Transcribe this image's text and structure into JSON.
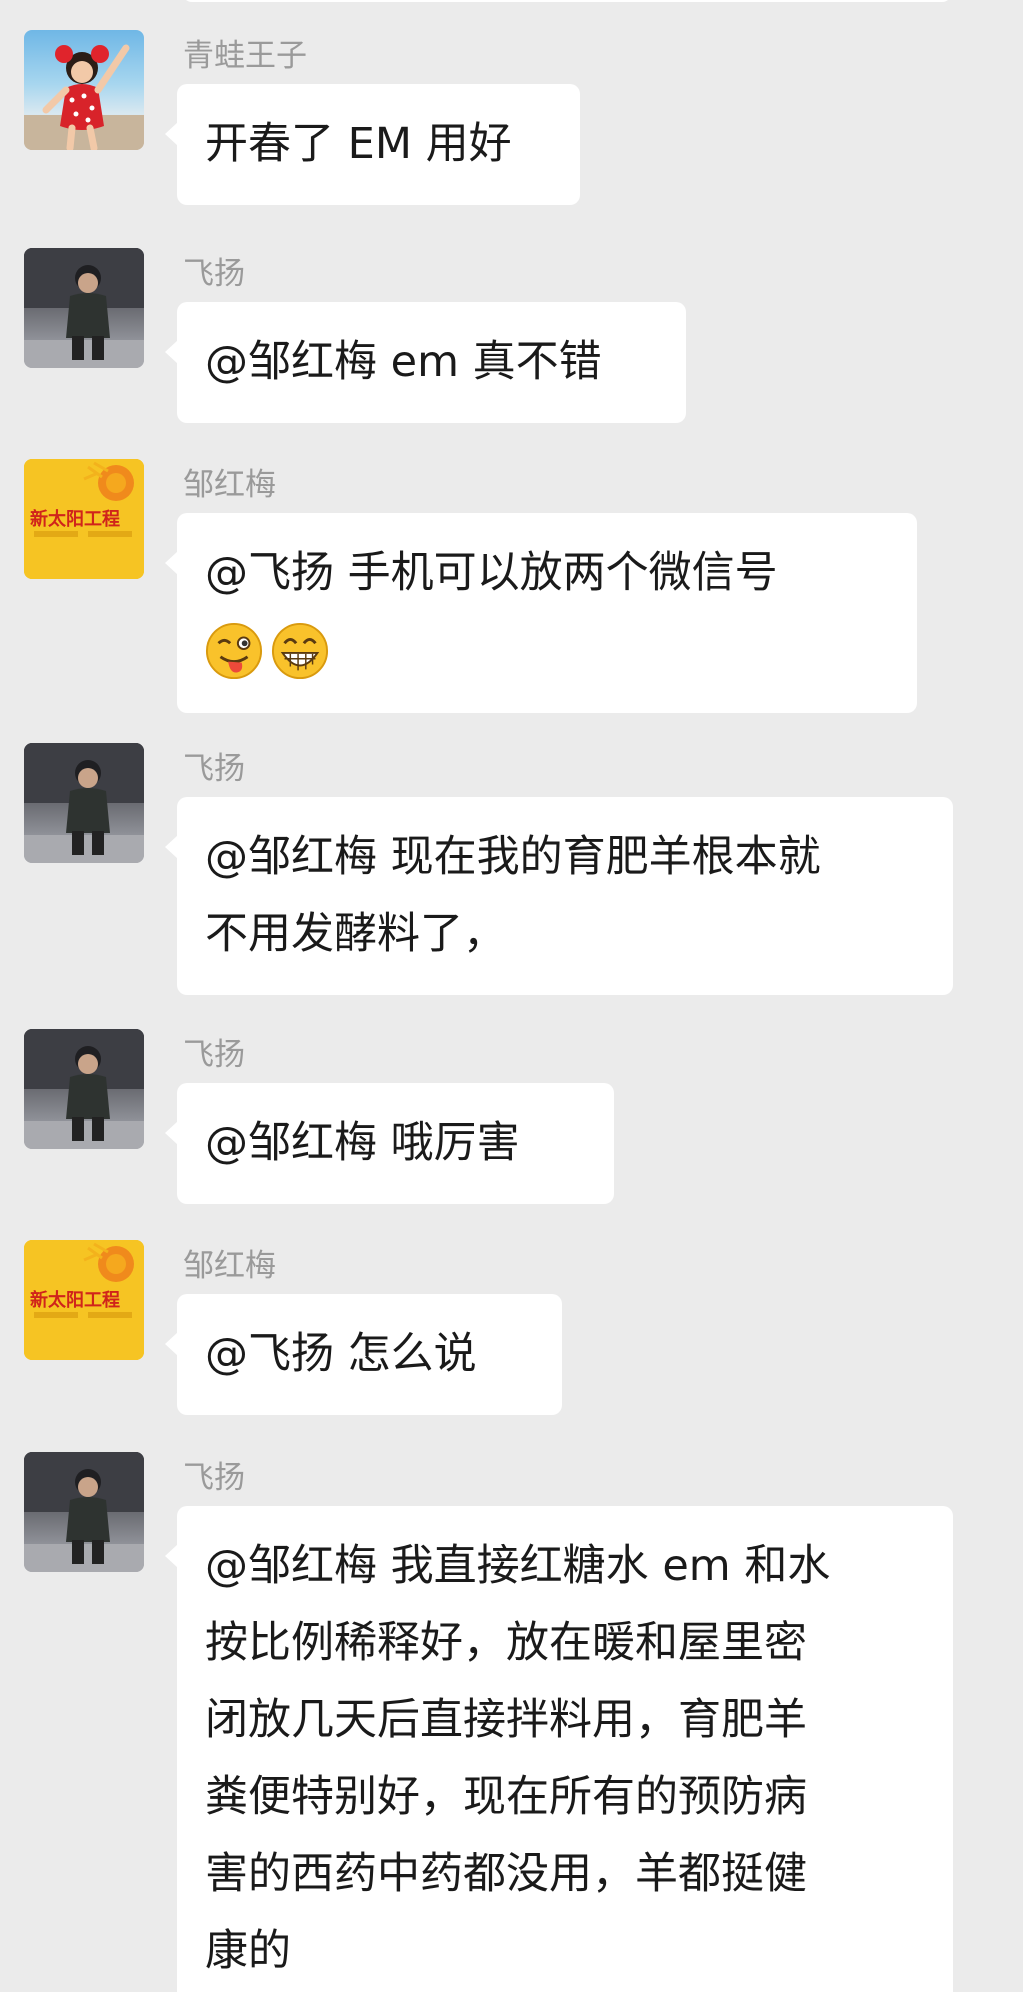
{
  "chat": {
    "messages": [
      {
        "sender": "青蛙王子",
        "avatar_icon": "girl-avatar",
        "lines": [
          "开春了 EM 用好"
        ]
      },
      {
        "sender": "飞扬",
        "avatar_icon": "boy-avatar",
        "lines": [
          "@邹红梅  em 真不错"
        ]
      },
      {
        "sender": "邹红梅",
        "avatar_icon": "sun-project-avatar",
        "avatar_text": "新太阳工程",
        "lines": [
          "@飞扬  手机可以放两个微信号"
        ],
        "emojis": [
          "wink-tongue-emoji",
          "grin-emoji"
        ]
      },
      {
        "sender": "飞扬",
        "avatar_icon": "boy-avatar",
        "lines": [
          "@邹红梅  现在我的育肥羊根本就",
          "不用发酵料了，"
        ]
      },
      {
        "sender": "飞扬",
        "avatar_icon": "boy-avatar",
        "lines": [
          "@邹红梅  哦厉害"
        ]
      },
      {
        "sender": "邹红梅",
        "avatar_icon": "sun-project-avatar",
        "avatar_text": "新太阳工程",
        "lines": [
          "@飞扬  怎么说"
        ]
      },
      {
        "sender": "飞扬",
        "avatar_icon": "boy-avatar",
        "lines": [
          "@邹红梅  我直接红糖水 em 和水",
          "按比例稀释好，放在暖和屋里密",
          "闭放几天后直接拌料用，育肥羊",
          "粪便特别好，现在所有的预防病",
          "害的西药中药都没用，羊都挺健",
          "康的"
        ]
      }
    ]
  },
  "colors": {
    "background": "#ebebeb",
    "bubble": "#ffffff",
    "sender_name": "#9a9a9a",
    "text": "#1a1a1a"
  }
}
